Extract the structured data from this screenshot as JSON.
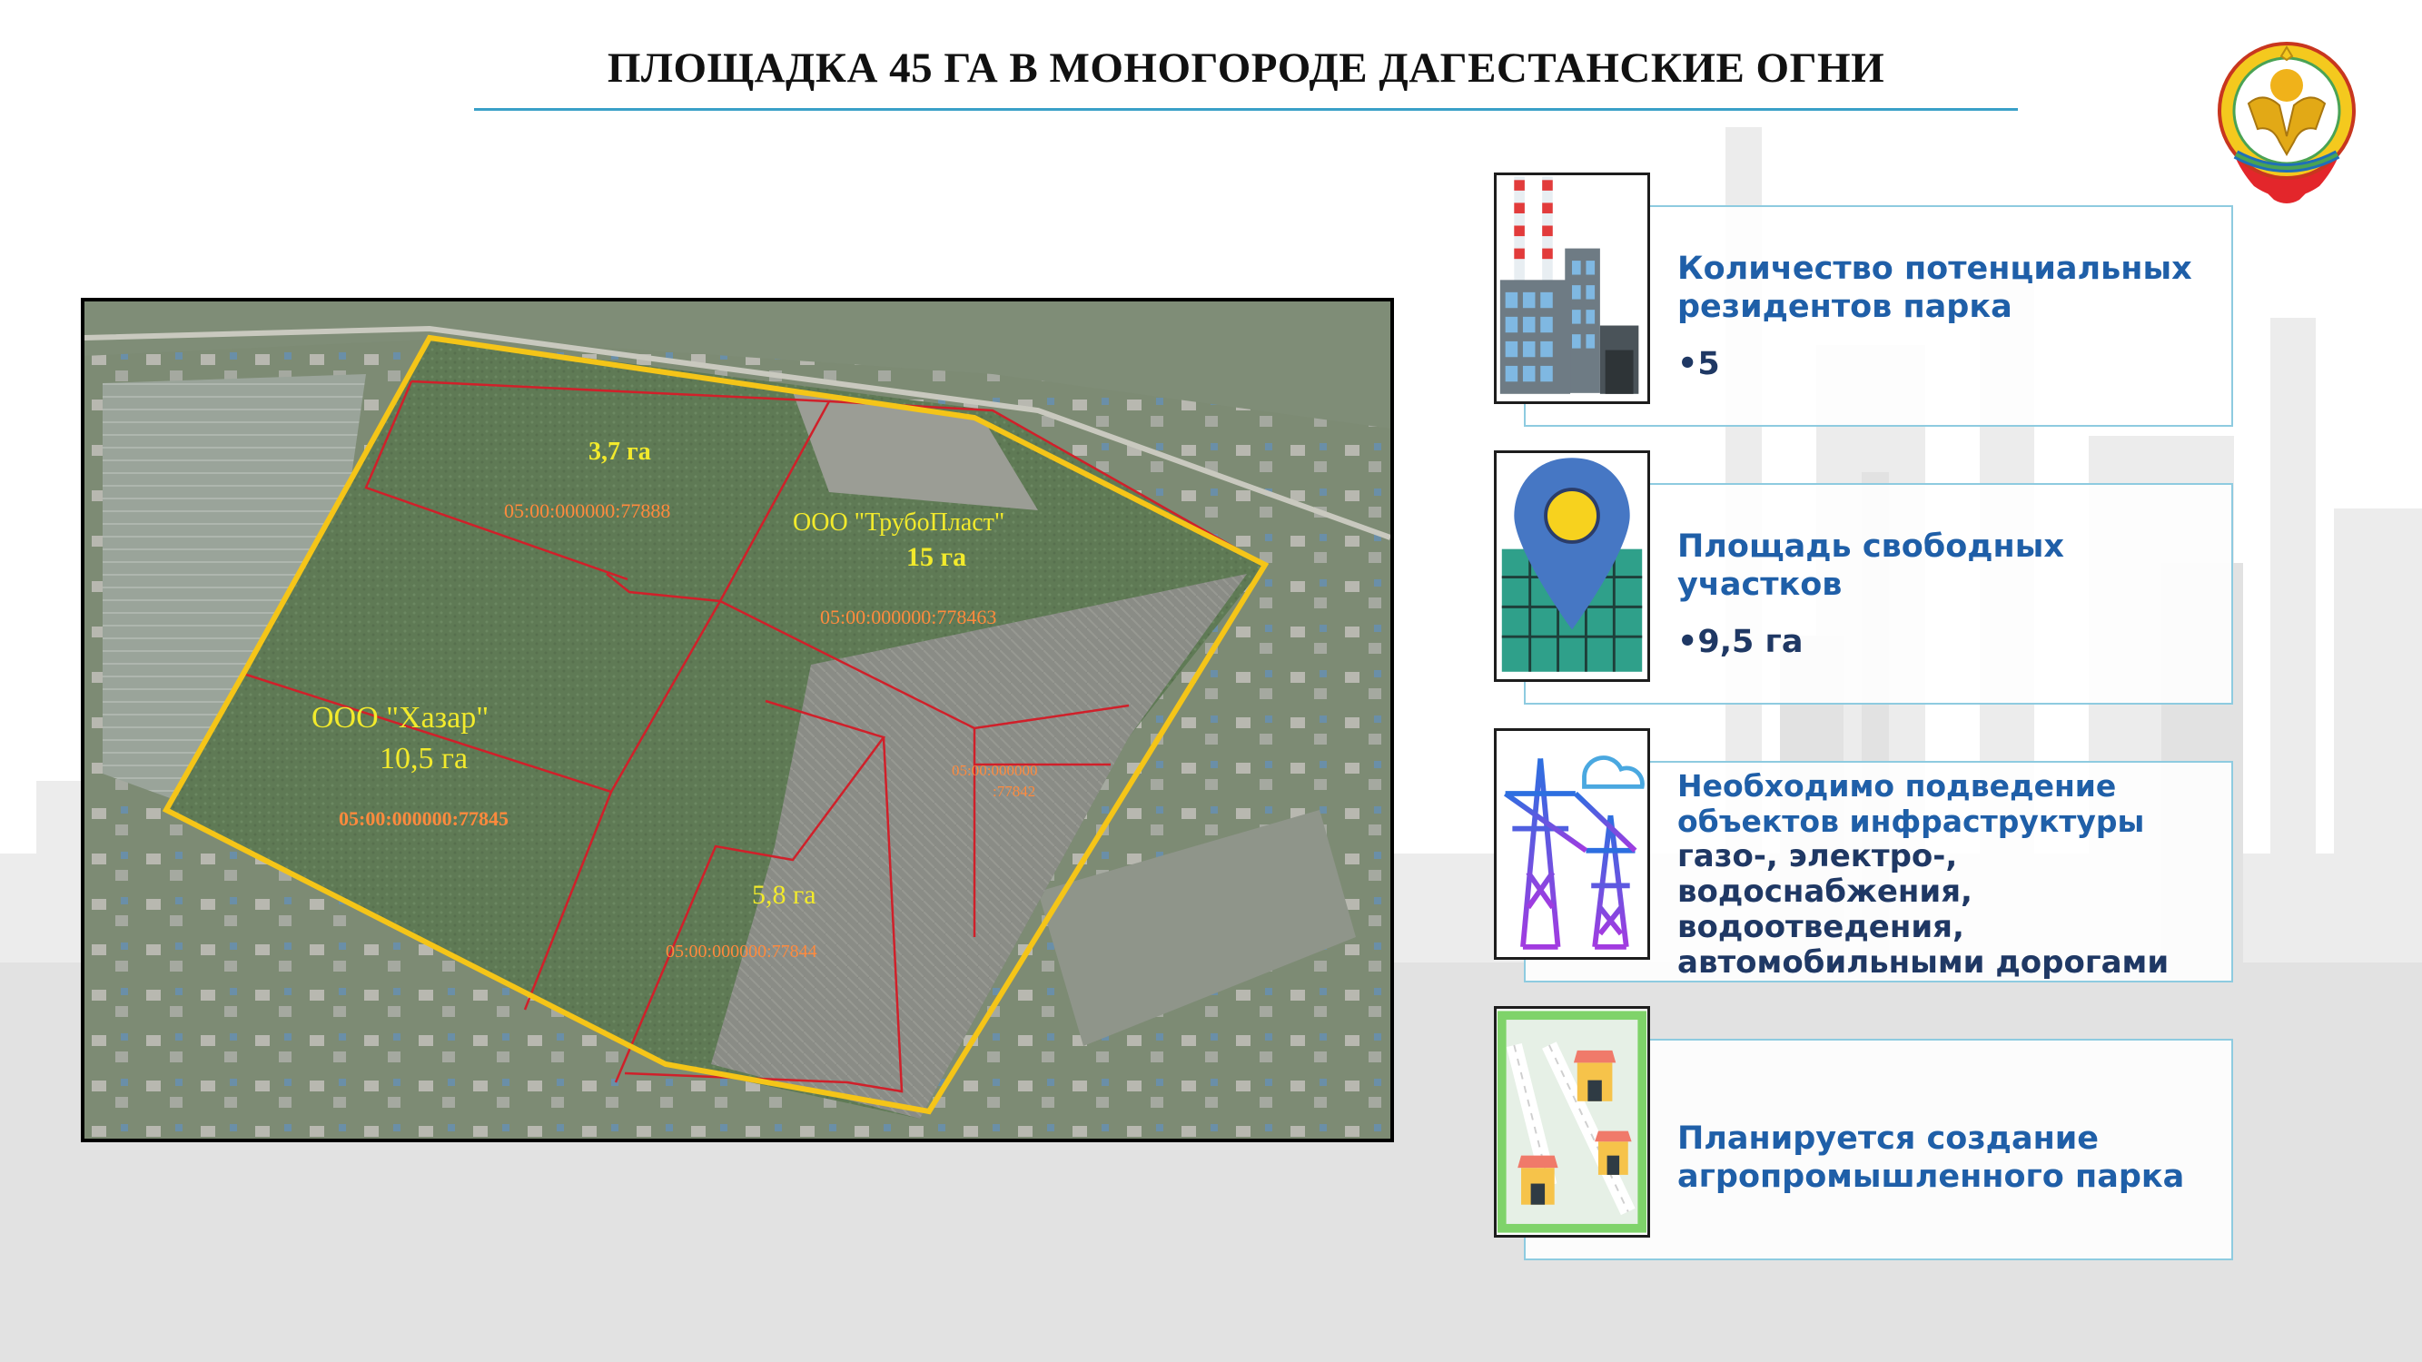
{
  "slide": {
    "title": "ПЛОЩАДКА 45 ГА В МОНОГОРОДЕ ДАГЕСТАНСКИЕ ОГНИ"
  },
  "map": {
    "plot_a": {
      "area": "3,7 га",
      "cadastral": "05:00:000000:77888"
    },
    "plot_b": {
      "owner": "ООО \"ТрубоПласт\"",
      "area": "15 га",
      "cadastral": "05:00:000000:778463"
    },
    "plot_c": {
      "owner": "ООО \"Хазар\"",
      "area": "10,5 га",
      "cadastral": "05:00:000000:77845"
    },
    "plot_d": {
      "area": "5,8 га",
      "cadastral": "05:00:000000:77844"
    },
    "plot_e": {
      "cadastral_line1": "05:00:000000",
      "cadastral_line2": ":77842"
    }
  },
  "cards": [
    {
      "heading": "Количество потенциальных резидентов парка",
      "value": "•5",
      "icon": "factory-icon"
    },
    {
      "heading": "Площадь свободных участков",
      "value": "•9,5 га",
      "icon": "map-pin-icon"
    },
    {
      "heading": "Необходимо подведение объектов инфраструктуры",
      "body": "газо-, электро-, водоснабжения, водоотведения, автомобильными дорогами",
      "icon": "power-tower-icon"
    },
    {
      "heading": "Планируется создание агропромышленного парка",
      "icon": "agro-park-icon"
    }
  ],
  "colors": {
    "accent_line": "#3aa0c8",
    "heading_blue": "#1f5fa8",
    "text_navy": "#1f3864",
    "boundary_yellow": "#f5c518",
    "plot_red": "#d0202a"
  }
}
